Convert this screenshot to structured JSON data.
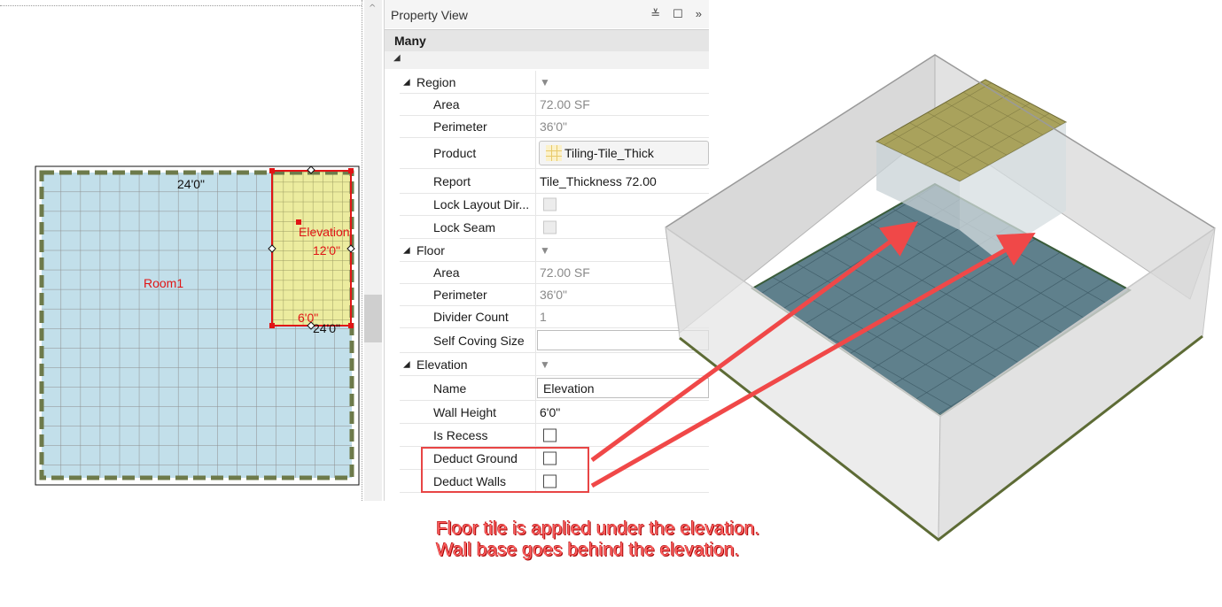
{
  "plan": {
    "room_label": "Room1",
    "dim_top": "24'0\"",
    "elevation_label": "Elevation",
    "dim_12": "12'0\"",
    "dim_6": "6'0\"",
    "dim_24b": "24'0\""
  },
  "property_view": {
    "title": "Property View",
    "header_buttons": [
      "≚",
      "☐",
      "»"
    ],
    "selection": "Many",
    "collapse_glyph": "◢",
    "categories": {
      "region": "Region",
      "floor": "Floor",
      "elevation": "Elevation"
    },
    "region": {
      "area_label": "Area",
      "area_value": "72.00 SF",
      "perimeter_label": "Perimeter",
      "perimeter_value": "36'0\"",
      "product_label": "Product",
      "product_value": "Tiling-Tile_Thick",
      "report_label": "Report",
      "report_value": "Tile_Thickness 72.00",
      "lock_layout_label": "Lock Layout Dir...",
      "lock_seam_label": "Lock Seam"
    },
    "floor": {
      "area_label": "Area",
      "area_value": "72.00 SF",
      "perimeter_label": "Perimeter",
      "perimeter_value": "36'0\"",
      "divider_label": "Divider Count",
      "divider_value": "1",
      "coving_label": "Self Coving Size",
      "coving_value": ""
    },
    "elevation": {
      "name_label": "Name",
      "name_value": "Elevation",
      "wall_height_label": "Wall Height",
      "wall_height_value": "6'0\"",
      "is_recess_label": "Is Recess",
      "deduct_ground_label": "Deduct Ground",
      "deduct_walls_label": "Deduct Walls"
    }
  },
  "annotation": {
    "line1": "Floor tile is applied under the elevation.",
    "line2": "Wall base goes behind the elevation."
  }
}
